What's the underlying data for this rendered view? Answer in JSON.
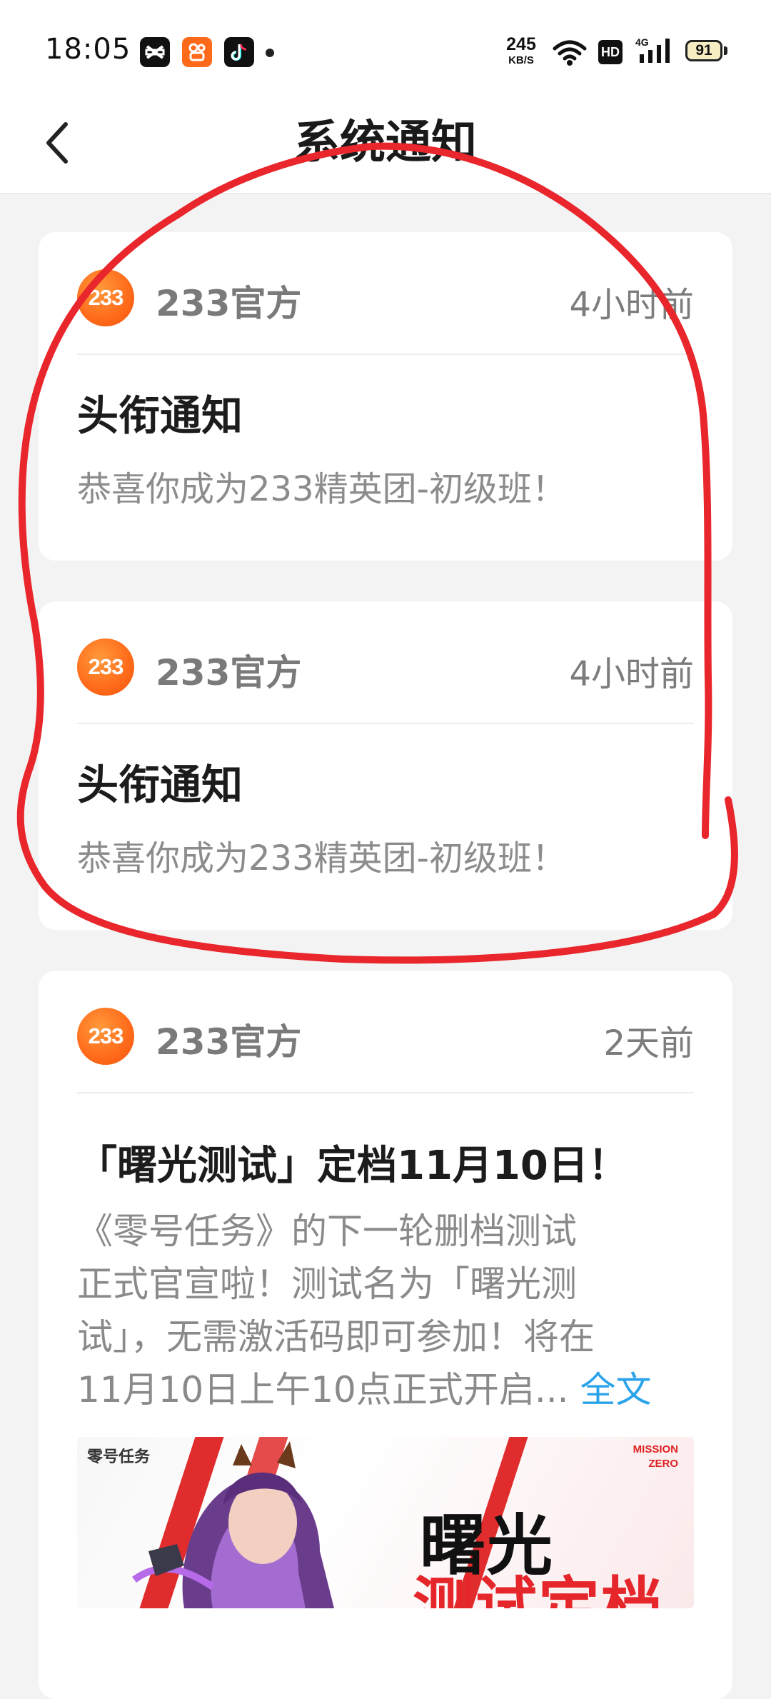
{
  "status_bar": {
    "time": "18:05",
    "app_icons": [
      "capcut-icon",
      "kuaishou-icon",
      "tiktok-icon"
    ],
    "net_speed_value": "245",
    "net_speed_unit": "KB/S",
    "hd_label": "HD",
    "signal_label": "4G",
    "battery": "91"
  },
  "header": {
    "title": "系统通知",
    "back_icon": "chevron-left-icon"
  },
  "notifications": [
    {
      "avatar_text": "233",
      "sender": "233官方",
      "time": "4小时前",
      "title": "头衔通知",
      "body": "恭喜你成为233精英团-初级班！"
    },
    {
      "avatar_text": "233",
      "sender": "233官方",
      "time": "4小时前",
      "title": "头衔通知",
      "body": "恭喜你成为233精英团-初级班！"
    },
    {
      "avatar_text": "233",
      "sender": "233官方",
      "time": "2天前",
      "title": "「曙光测试」定档11月10日！",
      "body_lines": [
        "《零号任务》的下一轮删档测试",
        "正式官宣啦！测试名为「曙光测",
        "试」，无需激活码即可参加！将在",
        "11月10日上午10点正式开启... "
      ],
      "full_text_link": "全文",
      "banner": {
        "brand": "零号任务",
        "mission_line1": "MISSION",
        "mission_line2": "ZERO",
        "headline1": "曙光",
        "headline2": "测试定档"
      }
    }
  ],
  "colors": {
    "accent_orange": "#ff6a1a",
    "link_blue": "#2aa3ea",
    "annotation_red": "#e8262b",
    "background": "#f3f3f3"
  }
}
